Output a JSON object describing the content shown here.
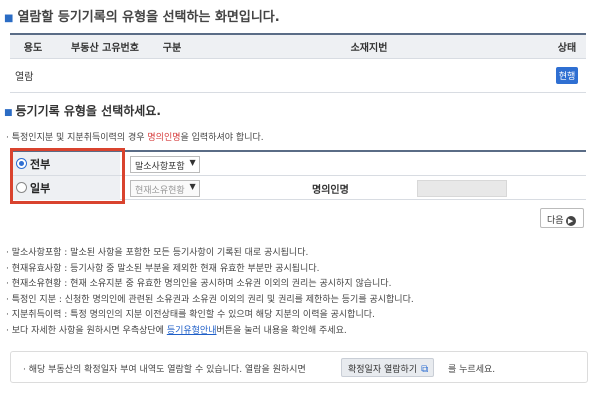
{
  "header": {
    "title": "열람할 등기기록의 유형을 선택하는 화면입니다."
  },
  "property_table": {
    "columns": [
      "용도",
      "부동산 고유번호",
      "구분",
      "소재지번",
      "상태"
    ],
    "rows": [
      {
        "usage": "열람",
        "unique_no": "",
        "type": "",
        "address": "",
        "status": "현행"
      }
    ]
  },
  "section": {
    "title": "등기기록 유형을 선택하세요.",
    "note_prefix": "특정인지분 및 지분취득이력의 경우 ",
    "note_highlight": "명의인명",
    "note_suffix": "을 입력하셔야 합니다."
  },
  "record_type": {
    "options": [
      {
        "label": "전부",
        "checked": true,
        "select_value": "말소사항포함"
      },
      {
        "label": "일부",
        "checked": false,
        "select_value": "현재소유현황"
      }
    ],
    "owner_label": "명의인명",
    "owner_value": ""
  },
  "next_button": {
    "label": "다음"
  },
  "descriptions": [
    "말소사항포함 : 말소된 사항을 포함한 모든 등기사항이 기록된 대로 공시됩니다.",
    "현재유효사항 : 등기사항 중 말소된 부분을 제외한 현재 유효한 부분만 공시됩니다.",
    "현재소유현황 : 현재 소유지분 중 유효한 명의인을 공시하며 소유권 이외의 권리는 공시하지 않습니다.",
    "특정인 지분 : 신청한 명의인에 관련된 소유권과 소유권 이외의 권리 및 권리를 제한하는 등기를 공시합니다.",
    "지분취득이력 : 특정 명의인의 지분 이전상태를 확인할 수 있으며 해당 지분의 이력을 공시합니다."
  ],
  "help_line": {
    "prefix": "보다 자세한 사항을 원하시면 우측상단에 ",
    "link": "등기유형안내",
    "suffix": "버튼을 눌러 내용을 확인해 주세요."
  },
  "bottom_box": {
    "text": "해당 부동산의 확정일자 부여 내역도 열람할 수 있습니다. 열람을 원하시면",
    "button_label": "확정일자 열람하기",
    "tail": "를 누르세요."
  },
  "colors": {
    "accent": "#2f6fd2",
    "highlight_box": "#d9432e",
    "header_border": "#5a6c86"
  }
}
